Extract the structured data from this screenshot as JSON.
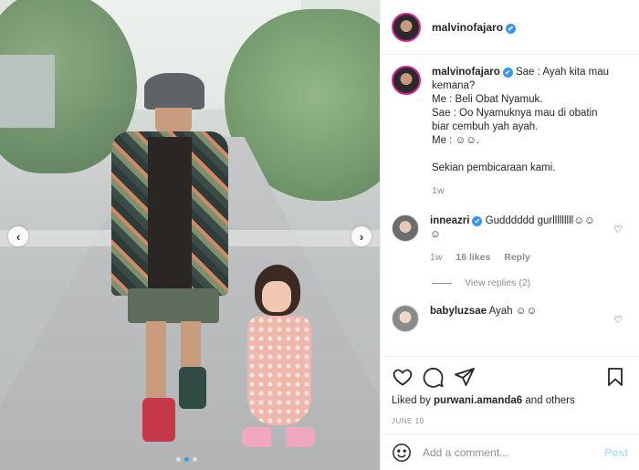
{
  "post": {
    "username": "malvinofajaro",
    "verified_badge": "✔",
    "caption_lines": [
      "Sae : Ayah kita mau",
      "kemana?",
      "Me : Beli Obat Nyamuk.",
      "Sae : Oo Nyamuknya mau di obatin",
      "biar cembuh yah ayah.",
      "Me : ☺☺.",
      "",
      "Sekian pembicaraan kami."
    ],
    "caption_age": "1w"
  },
  "comments": [
    {
      "username": "inneazri",
      "verified_badge": "✔",
      "text_line1": "Gudddddd gurlllllllll☺☺",
      "text_line2": "☺",
      "age": "1w",
      "likes": "16 likes",
      "reply": "Reply",
      "view_replies": "View replies (2)"
    },
    {
      "username": "babyluzsae",
      "text": "Ayah ☺☺"
    }
  ],
  "actions": {
    "liked_by_prefix": "Liked by ",
    "liked_by_user": "purwani.amanda6",
    "liked_by_suffix": " and others",
    "date": "JUNE 10"
  },
  "composer": {
    "placeholder": "Add a comment...",
    "post_label": "Post"
  },
  "carousel": {
    "prev": "‹",
    "next": "›",
    "slide_count": 3,
    "active_slide": 2,
    "accent_color": "#3897f0"
  }
}
